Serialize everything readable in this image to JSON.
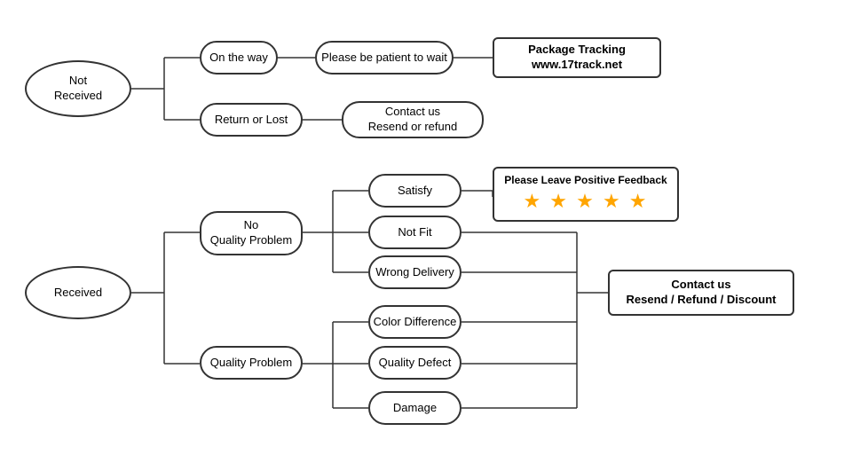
{
  "nodes": {
    "not_received": {
      "label": "Not\nReceived"
    },
    "on_the_way": {
      "label": "On the way"
    },
    "return_or_lost": {
      "label": "Return or Lost"
    },
    "patient": {
      "label": "Please be patient to wait"
    },
    "package_tracking": {
      "label": "Package Tracking\nwww.17track.net"
    },
    "contact_resend_refund": {
      "label": "Contact us\nResend or refund"
    },
    "received": {
      "label": "Received"
    },
    "no_quality_problem": {
      "label": "No\nQuality Problem"
    },
    "quality_problem": {
      "label": "Quality Problem"
    },
    "satisfy": {
      "label": "Satisfy"
    },
    "not_fit": {
      "label": "Not Fit"
    },
    "wrong_delivery": {
      "label": "Wrong Delivery"
    },
    "color_difference": {
      "label": "Color Difference"
    },
    "quality_defect": {
      "label": "Quality Defect"
    },
    "damage": {
      "label": "Damage"
    },
    "please_leave_feedback": {
      "label": "Please Leave Positive Feedback"
    },
    "stars": {
      "label": "★ ★ ★ ★ ★"
    },
    "contact_resend_refund_discount": {
      "label": "Contact us\nResend / Refund / Discount"
    }
  }
}
